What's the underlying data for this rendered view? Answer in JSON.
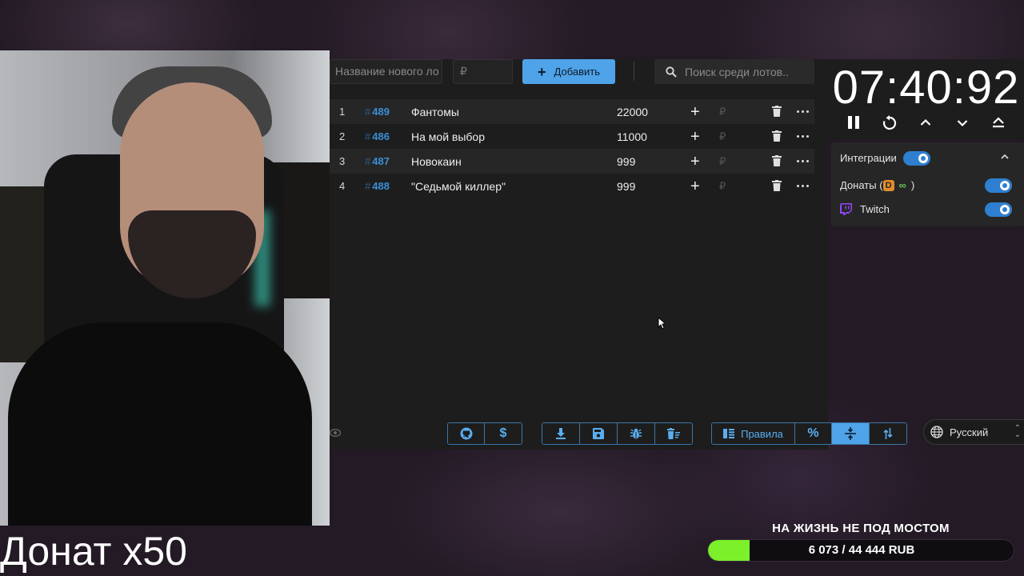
{
  "toolbar": {
    "name_placeholder": "Название нового ло",
    "price_placeholder": "₽",
    "add_label": "Добавить",
    "search_placeholder": "Поиск среди лотов.."
  },
  "lots": [
    {
      "num": "1",
      "id": "489",
      "title": "Фантомы",
      "amount": "22000",
      "rub": "₽"
    },
    {
      "num": "2",
      "id": "486",
      "title": "На мой выбор",
      "amount": "11000",
      "rub": "₽"
    },
    {
      "num": "3",
      "id": "487",
      "title": "Новокаин",
      "amount": "999",
      "rub": "₽"
    },
    {
      "num": "4",
      "id": "488",
      "title": "\"Седьмой киллер\"",
      "amount": "999",
      "rub": "₽"
    }
  ],
  "bottom": {
    "rules_label": "Правила",
    "language": "Русский"
  },
  "timer": {
    "value": "07:40:92"
  },
  "integrations": {
    "header": "Интеграции",
    "donations_label": "Донаты (",
    "donations_close": ")",
    "twitch_label": "Twitch"
  },
  "overlay": {
    "caption": "Донат x50",
    "goal_title": "НА ЖИЗНЬ НЕ ПОД МОСТОМ",
    "goal_text": "6 073 / 44 444 RUB",
    "goal_progress": 0.137
  },
  "colors": {
    "accent": "#4fa3e8",
    "goal_fill": "#7cf02a",
    "id_color": "#3a8fd6"
  }
}
